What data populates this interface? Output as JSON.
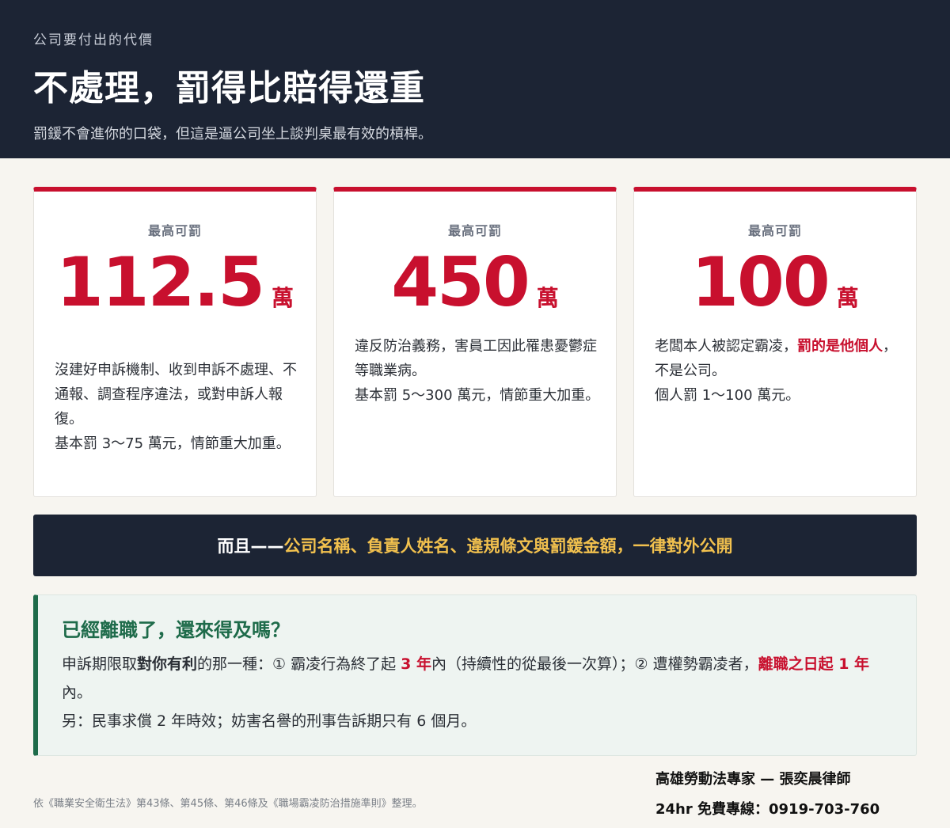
{
  "header": {
    "eyebrow": "公司要付出的代價",
    "title": "不處理，罰得比賠得還重",
    "subtitle": "罰鍰不會進你的口袋，但這是逼公司坐上談判桌最有效的槓桿。"
  },
  "cards": [
    {
      "kicker": "最高可罰",
      "number": "112.5",
      "unit": "萬",
      "desc_1": "沒建好申訴機制、收到申訴不處理、不通報、調查程序違法，或對申訴人報復。",
      "desc_2": "基本罰 3～75 萬元，情節重大加重。"
    },
    {
      "kicker": "最高可罰",
      "number": "450",
      "unit": "萬",
      "desc_1": "違反防治義務，害員工因此罹患憂鬱症等職業病。",
      "desc_2": "基本罰 5～300 萬元，情節重大加重。"
    },
    {
      "kicker": "最高可罰",
      "number": "100",
      "unit": "萬",
      "desc_1a": "老闆本人被認定霸凌，",
      "desc_1b": "罰的是他個人",
      "desc_1c": "，不是公司。",
      "desc_2": "個人罰 1～100 萬元。"
    }
  ],
  "banner": {
    "lead": "而且——",
    "body": "公司名稱、負責人姓名、違規條文與罰鍰金額，一律對外公開"
  },
  "note": {
    "title": "已經離職了，還來得及嗎？",
    "p1_a": "申訴期限取",
    "p1_b": "對你有利",
    "p1_c": "的那一種：① 霸凌行為終了起 ",
    "p1_d": "3 年",
    "p1_e": "內（持續性的從最後一次算）；② 遭權勢霸凌者，",
    "p1_f": "離職之日起 1 年",
    "p1_g": "內。",
    "p2": "另：民事求償 2 年時效；妨害名譽的刑事告訴期只有 6 個月。"
  },
  "footer": {
    "source": "依《職業安全衛生法》第43條、第45條、第46條及《職場霸凌防治措施準則》整理。",
    "contact_name": "高雄勞動法專家 — 張奕晨律師",
    "contact_phone": "24hr 免費專線：0919-703-760"
  },
  "colors": {
    "navy": "#1c2434",
    "red": "#c8102e",
    "gold": "#f2c14e",
    "green": "#1e6b4a"
  }
}
